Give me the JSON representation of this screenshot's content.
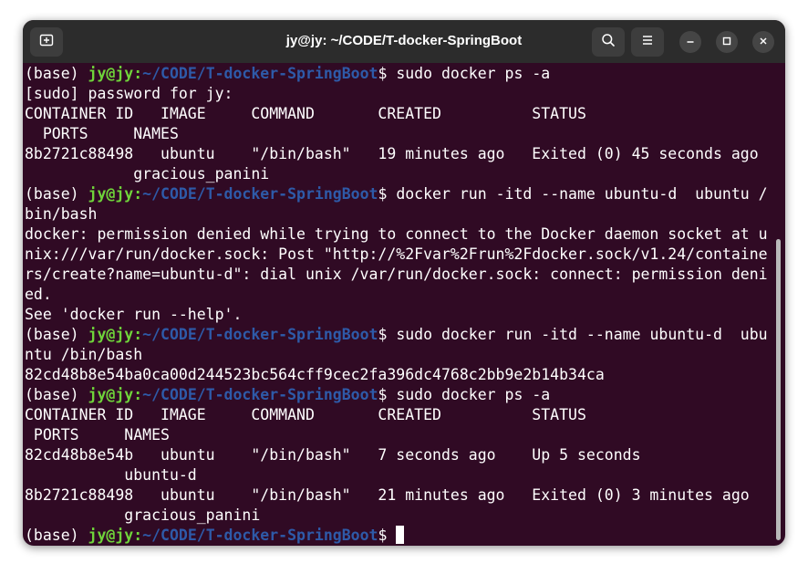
{
  "window": {
    "title": "jy@jy: ~/CODE/T-docker-SpringBoot"
  },
  "colors": {
    "terminal_bg": "#300a24",
    "user_host": "#6fd43a",
    "path": "#2e5aa8",
    "text": "#ffffff"
  },
  "icons": {
    "new_tab": "new-tab-icon",
    "search": "search-icon",
    "menu": "hamburger-menu-icon",
    "minimize": "minimize-icon",
    "maximize": "maximize-icon",
    "close": "close-icon"
  },
  "terminal": {
    "lines": [
      {
        "type": "prompt",
        "env": "(base) ",
        "user": "jy@jy",
        "sep": ":",
        "path": "~/CODE/T-docker-SpringBoot",
        "symbol": "$ ",
        "cmd": "sudo docker ps -a"
      },
      {
        "type": "text",
        "text": "[sudo] password for jy:"
      },
      {
        "type": "text",
        "text": "CONTAINER ID   IMAGE     COMMAND       CREATED          STATUS"
      },
      {
        "type": "text",
        "text": "  PORTS     NAMES"
      },
      {
        "type": "text",
        "text": "8b2721c88498   ubuntu    \"/bin/bash\"   19 minutes ago   Exited (0) 45 seconds ago"
      },
      {
        "type": "text",
        "text": "            gracious_panini"
      },
      {
        "type": "prompt",
        "env": "(base) ",
        "user": "jy@jy",
        "sep": ":",
        "path": "~/CODE/T-docker-SpringBoot",
        "symbol": "$ ",
        "cmd": "docker run -itd --name ubuntu-d  ubuntu /"
      },
      {
        "type": "text",
        "text": "bin/bash"
      },
      {
        "type": "text",
        "text": "docker: permission denied while trying to connect to the Docker daemon socket at u"
      },
      {
        "type": "text",
        "text": "nix:///var/run/docker.sock: Post \"http://%2Fvar%2Frun%2Fdocker.sock/v1.24/containe"
      },
      {
        "type": "text",
        "text": "rs/create?name=ubuntu-d\": dial unix /var/run/docker.sock: connect: permission deni"
      },
      {
        "type": "text",
        "text": "ed."
      },
      {
        "type": "text",
        "text": "See 'docker run --help'."
      },
      {
        "type": "prompt",
        "env": "(base) ",
        "user": "jy@jy",
        "sep": ":",
        "path": "~/CODE/T-docker-SpringBoot",
        "symbol": "$ ",
        "cmd": "sudo docker run -itd --name ubuntu-d  ubu"
      },
      {
        "type": "text",
        "text": "ntu /bin/bash"
      },
      {
        "type": "text",
        "text": "82cd48b8e54ba0ca00d244523bc564cff9cec2fa396dc4768c2bb9e2b14b34ca"
      },
      {
        "type": "prompt",
        "env": "(base) ",
        "user": "jy@jy",
        "sep": ":",
        "path": "~/CODE/T-docker-SpringBoot",
        "symbol": "$ ",
        "cmd": "sudo docker ps -a"
      },
      {
        "type": "text",
        "text": "CONTAINER ID   IMAGE     COMMAND       CREATED          STATUS"
      },
      {
        "type": "text",
        "text": " PORTS     NAMES"
      },
      {
        "type": "text",
        "text": "82cd48b8e54b   ubuntu    \"/bin/bash\"   7 seconds ago    Up 5 seconds"
      },
      {
        "type": "text",
        "text": "           ubuntu-d"
      },
      {
        "type": "text",
        "text": "8b2721c88498   ubuntu    \"/bin/bash\"   21 minutes ago   Exited (0) 3 minutes ago"
      },
      {
        "type": "text",
        "text": "           gracious_panini"
      },
      {
        "type": "prompt",
        "env": "(base) ",
        "user": "jy@jy",
        "sep": ":",
        "path": "~/CODE/T-docker-SpringBoot",
        "symbol": "$ ",
        "cmd": "",
        "cursor": true
      }
    ]
  }
}
